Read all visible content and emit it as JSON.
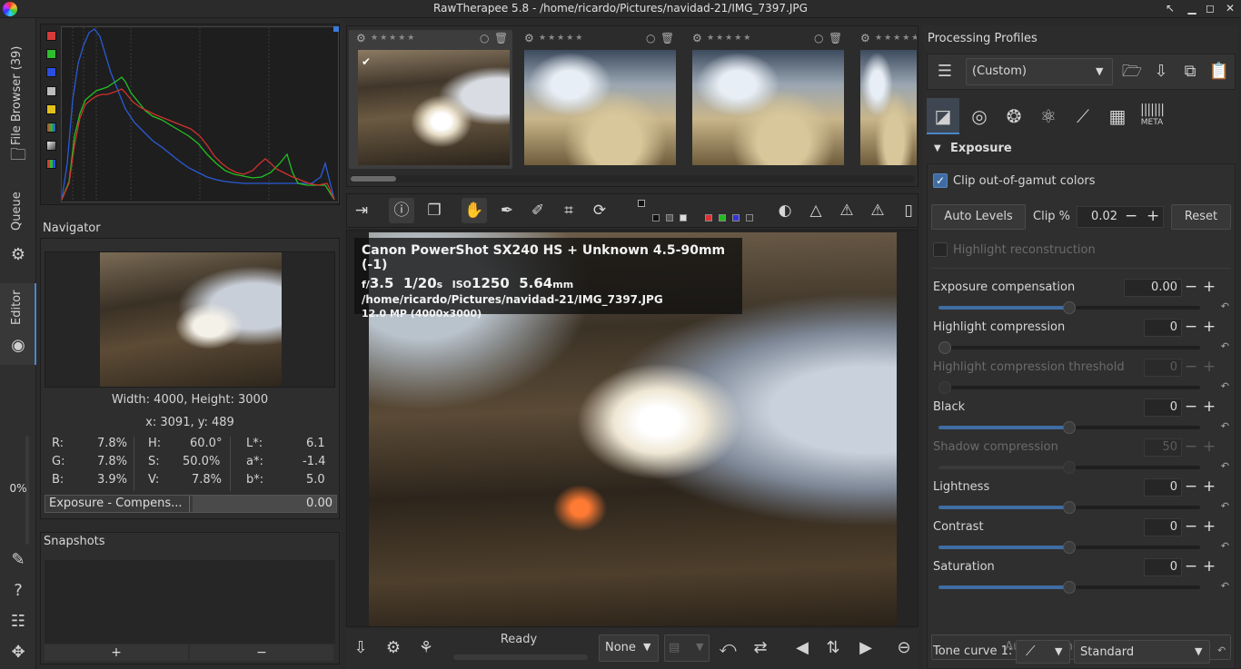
{
  "window": {
    "title": "RawTherapee 5.8 - /home/ricardo/Pictures/navidad-21/IMG_7397.JPG"
  },
  "side_tabs": {
    "file_browser": "File Browser (39)",
    "queue": "Queue",
    "editor": "Editor",
    "progress": "0%"
  },
  "navigator": {
    "title": "Navigator",
    "dimensions": "Width: 4000, Height: 3000",
    "position": "x: 3091, y: 489",
    "col1": {
      "r_label": "R:",
      "r": "7.8%",
      "g_label": "G:",
      "g": "7.8%",
      "b_label": "B:",
      "b": "3.9%"
    },
    "col2": {
      "h_label": "H:",
      "h": "60.0°",
      "s_label": "S:",
      "s": "50.0%",
      "v_label": "V:",
      "v": "7.8%"
    },
    "col3": {
      "l_label": "L*:",
      "l": "6.1",
      "a_label": "a*:",
      "a": "-1.4",
      "bb_label": "b*:",
      "bb": "5.0"
    }
  },
  "history": {
    "item_label": "Exposure - Compens...",
    "item_value": "0.00"
  },
  "snapshots": {
    "title": "Snapshots",
    "add": "+",
    "remove": "−"
  },
  "filmstrip": {
    "thumbs": [
      {
        "selected": true
      },
      {
        "selected": false
      },
      {
        "selected": false
      },
      {
        "selected": false
      }
    ]
  },
  "image_info": {
    "camera": "Canon PowerShot SX240 HS + Unknown 4.5-90mm (-1)",
    "f_prefix": "f/",
    "aperture": "3.5",
    "shutter": "1/20",
    "shutter_unit": "s",
    "iso_label": "ISO",
    "iso": "1250",
    "focal": "5.64",
    "focal_unit": "mm",
    "path": "/home/ricardo/Pictures/navidad-21/IMG_7397.JPG",
    "megapixels": "12.0 MP (4000x3000)"
  },
  "statusbar": {
    "status": "Ready",
    "preset": "None"
  },
  "processing_profiles": {
    "title": "Processing Profiles",
    "current": "(Custom)"
  },
  "tool_tabs": {
    "meta_label": "META"
  },
  "exposure": {
    "title": "Exposure",
    "clip_gamut": "Clip out-of-gamut colors",
    "auto_levels": "Auto Levels",
    "clip_label": "Clip %",
    "clip_value": "0.02",
    "reset": "Reset",
    "highlight_reconstruction": "Highlight reconstruction",
    "params": [
      {
        "label": "Exposure compensation",
        "value": "0.00",
        "fraction": 0.5,
        "dim": false
      },
      {
        "label": "Highlight compression",
        "value": "0",
        "fraction": 0.0,
        "dim": false
      },
      {
        "label": "Highlight compression threshold",
        "value": "0",
        "fraction": 0.0,
        "dim": true
      },
      {
        "label": "Black",
        "value": "0",
        "fraction": 0.5,
        "dim": false
      },
      {
        "label": "Shadow compression",
        "value": "50",
        "fraction": 0.5,
        "dim": true
      },
      {
        "label": "Lightness",
        "value": "0",
        "fraction": 0.5,
        "dim": false
      },
      {
        "label": "Contrast",
        "value": "0",
        "fraction": 0.5,
        "dim": false
      },
      {
        "label": "Saturation",
        "value": "0",
        "fraction": 0.5,
        "dim": false
      }
    ],
    "auto_matched": "Auto-Matched Tone Curve",
    "tone_curve_label": "Tone curve 1:",
    "tone_curve_mode": "Standard"
  },
  "colors": {
    "accent": "#3f6da3",
    "histogram_red": "#d0312d",
    "histogram_green": "#22c022",
    "histogram_blue": "#2a5bd7"
  }
}
